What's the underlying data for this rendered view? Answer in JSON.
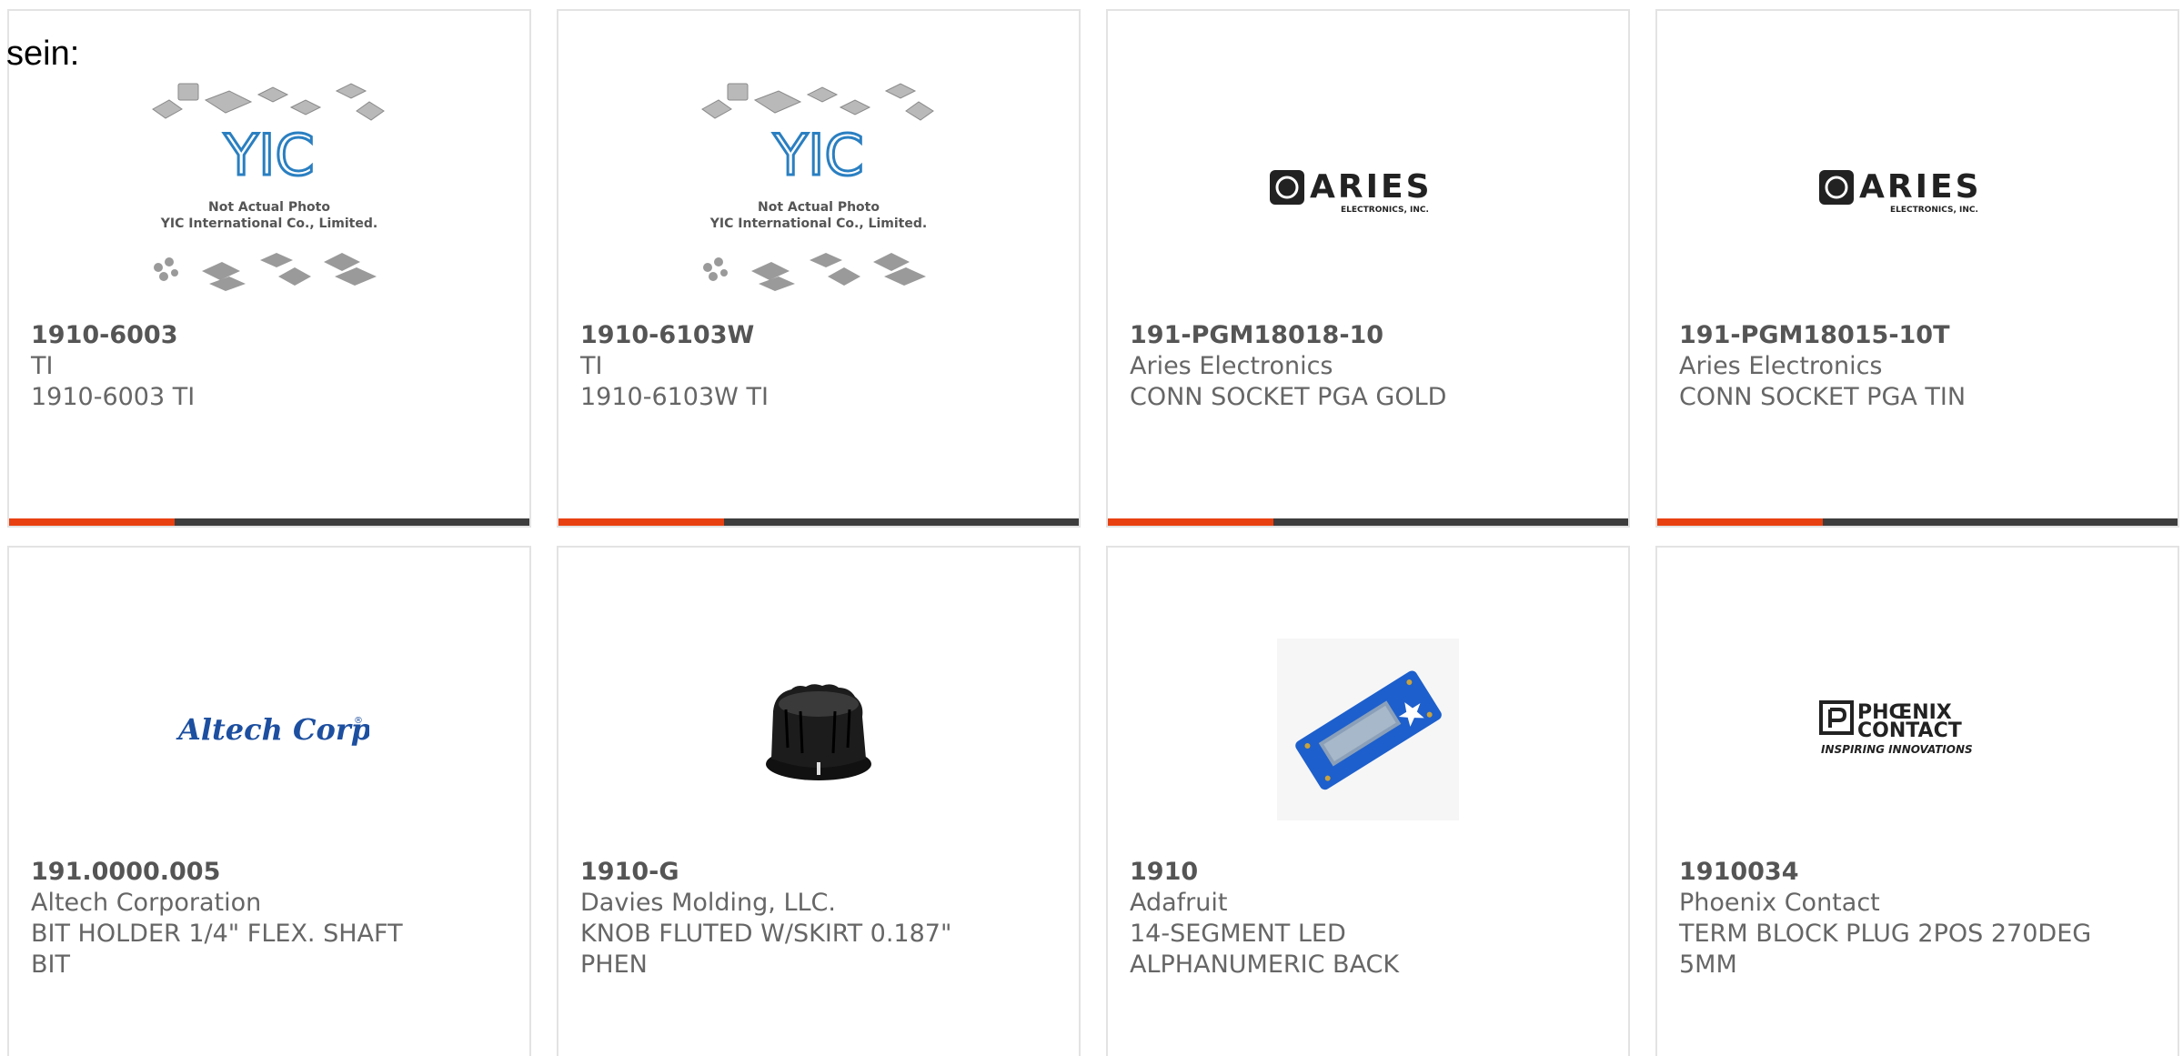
{
  "stray_text": "sein:",
  "accent_color": "#e84010",
  "bar_color": "#3d3d3d",
  "products": [
    {
      "part": "1910-6003",
      "manufacturer": "TI",
      "description": "1910-6003 TI",
      "image": "yic-placeholder",
      "image_text": [
        "Not Actual Photo",
        "YIC International Co., Limited."
      ],
      "logo": "YIC"
    },
    {
      "part": "1910-6103W",
      "manufacturer": "TI",
      "description": "1910-6103W TI",
      "image": "yic-placeholder",
      "image_text": [
        "Not Actual Photo",
        "YIC International Co., Limited."
      ],
      "logo": "YIC"
    },
    {
      "part": "191-PGM18018-10",
      "manufacturer": "Aries Electronics",
      "description": "CONN SOCKET PGA GOLD",
      "image": "aries-logo",
      "logo": "ARIES",
      "logo_sub": "ELECTRONICS, INC."
    },
    {
      "part": "191-PGM18015-10T",
      "manufacturer": "Aries Electronics",
      "description": "CONN SOCKET PGA TIN",
      "image": "aries-logo",
      "logo": "ARIES",
      "logo_sub": "ELECTRONICS, INC."
    },
    {
      "part": "191.0000.005",
      "manufacturer": "Altech Corporation",
      "description_lines": [
        "BIT HOLDER 1/4\" FLEX. SHAFT",
        "BIT"
      ],
      "image": "altech-logo",
      "logo": "Altech Corp."
    },
    {
      "part": "1910-G",
      "manufacturer": "Davies Molding, LLC.",
      "description_lines": [
        "KNOB FLUTED W/SKIRT 0.187\"",
        "PHEN"
      ],
      "image": "knob-photo"
    },
    {
      "part": "1910",
      "manufacturer": "Adafruit",
      "description_lines": [
        "14-SEGMENT LED",
        "ALPHANUMERIC BACK"
      ],
      "image": "led-board-photo"
    },
    {
      "part": "1910034",
      "manufacturer": "Phoenix Contact",
      "description_lines": [
        "TERM BLOCK PLUG 2POS 270DEG",
        "5MM"
      ],
      "image": "phoenix-logo",
      "logo": [
        "PHŒNIX",
        "CONTACT"
      ],
      "logo_sub": "INSPIRING INNOVATIONS"
    }
  ]
}
